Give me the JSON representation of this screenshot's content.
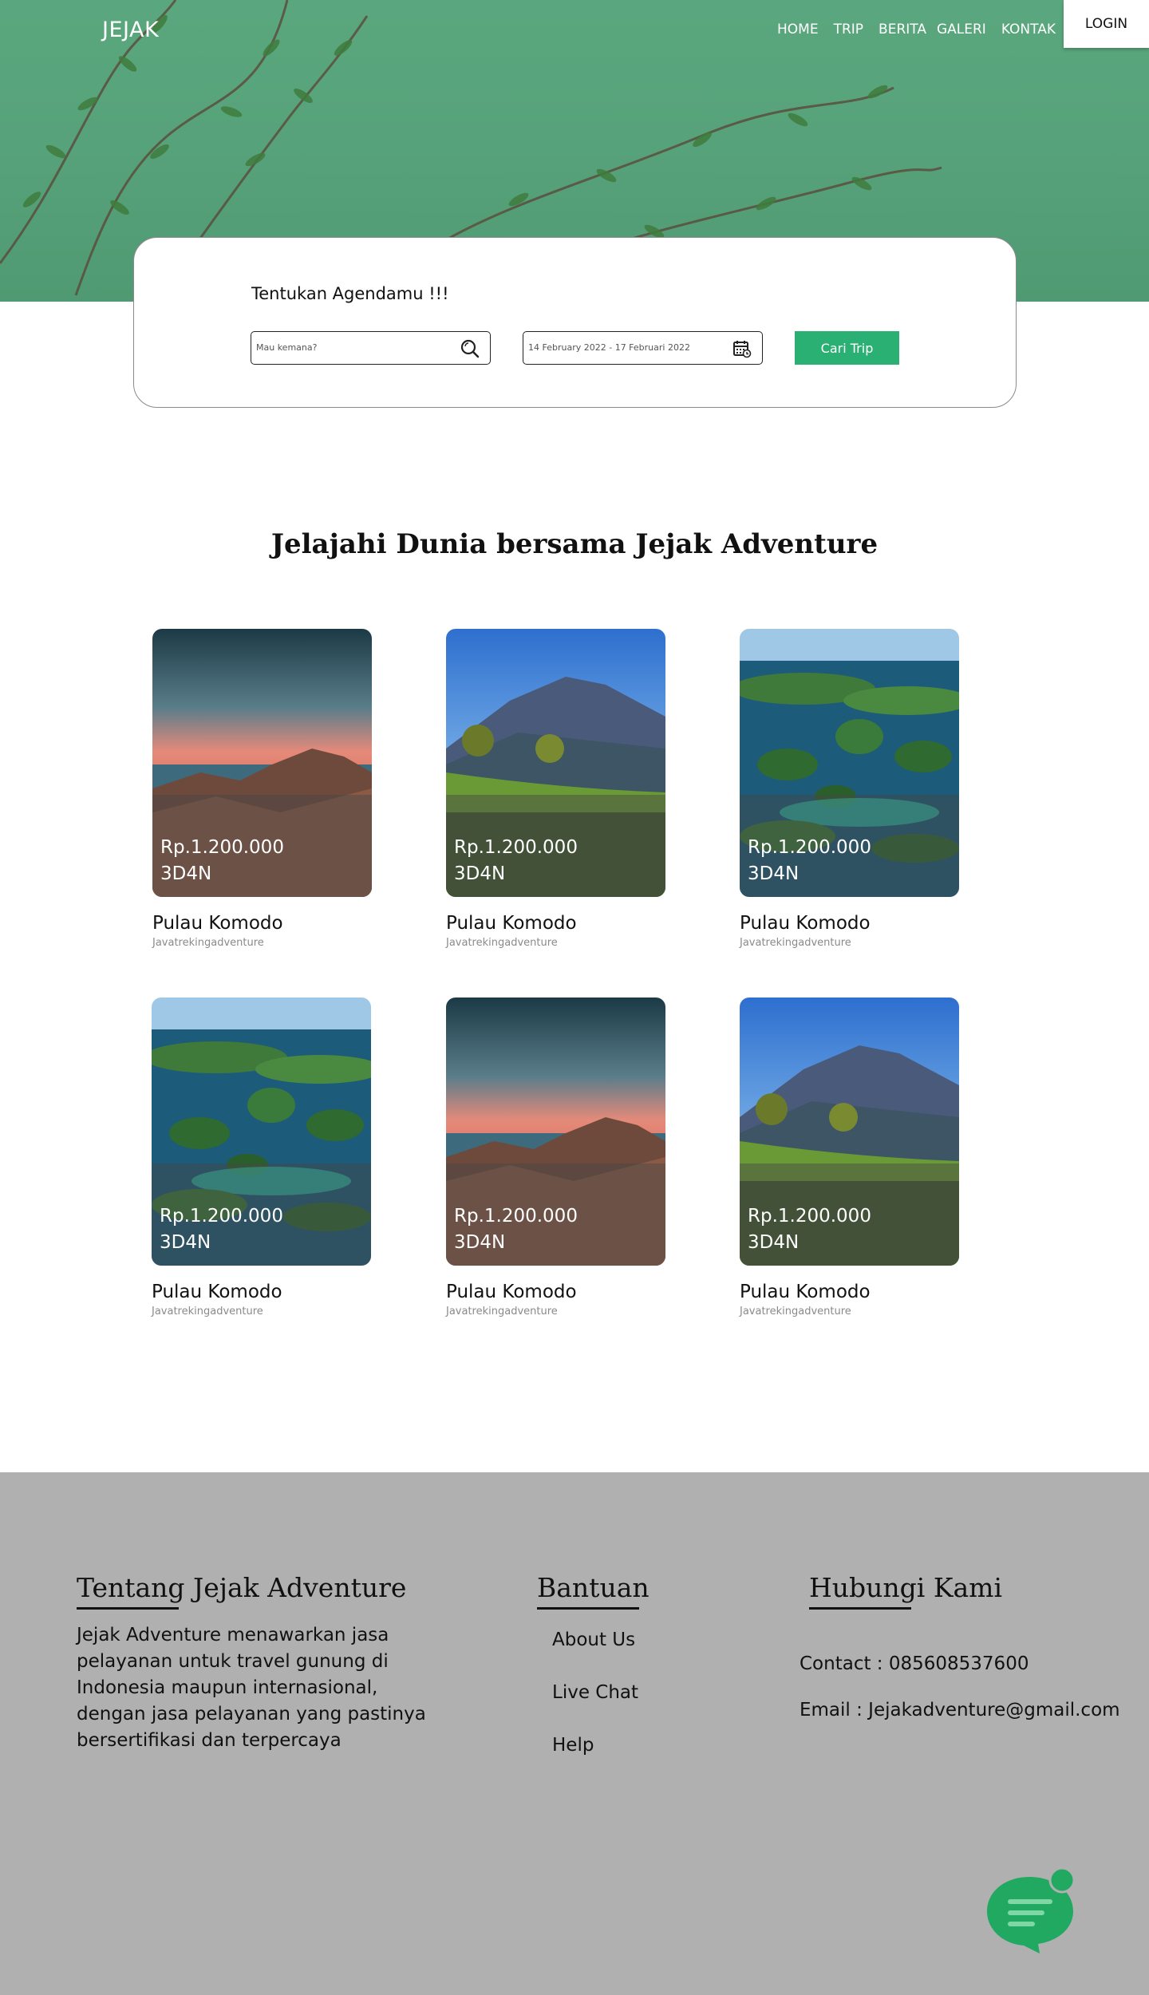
{
  "header": {
    "logo": "JEJAK",
    "nav": [
      "HOME",
      "TRIP",
      "BERITA",
      "GALERI",
      "KONTAK"
    ],
    "login_label": "LOGIN"
  },
  "search": {
    "title": "Tentukan Agendamu !!!",
    "destination_placeholder": "Mau kemana?",
    "date_range_value": "14 February 2022 - 17 Februari 2022",
    "button_label": "Cari Trip"
  },
  "main": {
    "title": "Jelajahi Dunia bersama Jejak Adventure",
    "trips": [
      {
        "price": "Rp.1.200.000",
        "duration": "3D4N",
        "name": "Pulau Komodo",
        "operator": "Javatrekingadventure",
        "scene": "sunset"
      },
      {
        "price": "Rp.1.200.000",
        "duration": "3D4N",
        "name": "Pulau Komodo",
        "operator": "Javatrekingadventure",
        "scene": "mountain"
      },
      {
        "price": "Rp.1.200.000",
        "duration": "3D4N",
        "name": "Pulau Komodo",
        "operator": "Javatrekingadventure",
        "scene": "islands"
      },
      {
        "price": "Rp.1.200.000",
        "duration": "3D4N",
        "name": "Pulau Komodo",
        "operator": "Javatrekingadventure",
        "scene": "islands"
      },
      {
        "price": "Rp.1.200.000",
        "duration": "3D4N",
        "name": "Pulau Komodo",
        "operator": "Javatrekingadventure",
        "scene": "sunset"
      },
      {
        "price": "Rp.1.200.000",
        "duration": "3D4N",
        "name": "Pulau Komodo",
        "operator": "Javatrekingadventure",
        "scene": "mountain"
      }
    ]
  },
  "footer": {
    "about": {
      "title": "Tentang Jejak Adventure",
      "lines": [
        "Jejak Adventure menawarkan jasa",
        "pelayanan untuk travel gunung di",
        "Indonesia maupun internasional,",
        "dengan jasa pelayanan yang pastinya",
        "bersertifikasi dan terpercaya"
      ]
    },
    "help": {
      "title": "Bantuan",
      "links": [
        "About Us",
        "Live Chat",
        "Help"
      ]
    },
    "contact": {
      "title": "Hubungi Kami",
      "phone": "Contact : 085608537600",
      "email": "Email : Jejakadventure@gmail.com"
    }
  },
  "colors": {
    "hero_green": "#56a179",
    "accent_green": "#2bb074",
    "footer_gray": "#b0b0b0"
  },
  "icons": {
    "search": "search-icon",
    "calendar": "calendar-icon",
    "chat": "chat-bubble-icon"
  }
}
